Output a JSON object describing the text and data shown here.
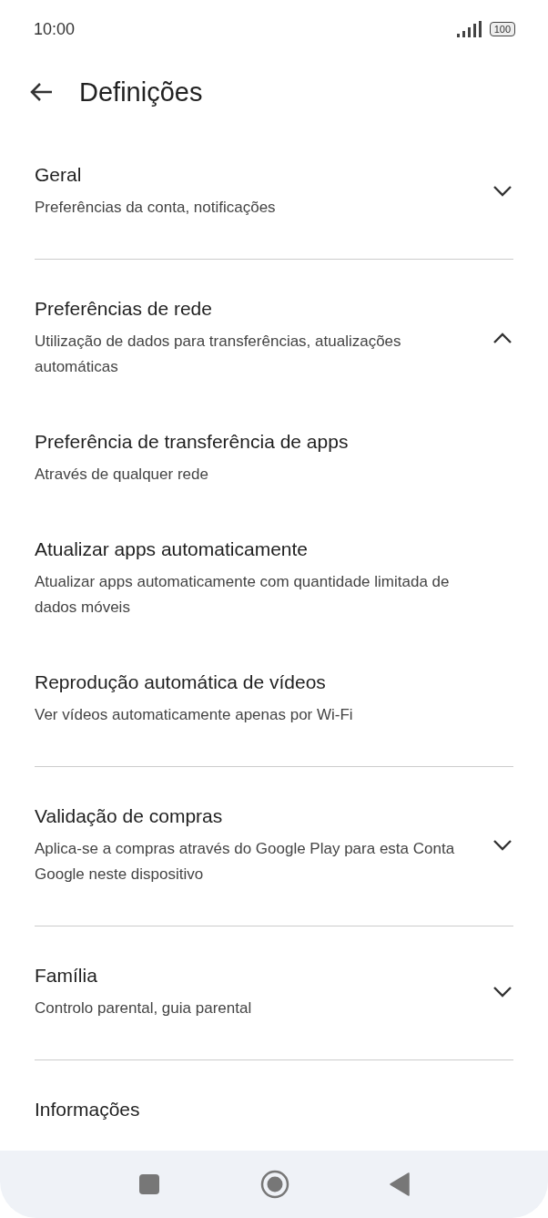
{
  "status_bar": {
    "time": "10:00",
    "battery": "100"
  },
  "header": {
    "title": "Definições"
  },
  "sections": [
    {
      "title": "Geral",
      "subtitle": "Preferências da conta, notificações",
      "expanded": false
    },
    {
      "title": "Preferências de rede",
      "subtitle": "Utilização de dados para transferências, atualizações automáticas",
      "expanded": true,
      "children": [
        {
          "title": "Preferência de transferência de apps",
          "subtitle": "Através de qualquer rede"
        },
        {
          "title": "Atualizar apps automaticamente",
          "subtitle": "Atualizar apps automaticamente com quantidade limitada de dados móveis"
        },
        {
          "title": "Reprodução automática de vídeos",
          "subtitle": "Ver vídeos automaticamente apenas por Wi-Fi"
        }
      ]
    },
    {
      "title": "Validação de compras",
      "subtitle": "Aplica-se a compras através do Google Play para esta Conta Google neste dispositivo",
      "expanded": false
    },
    {
      "title": "Família",
      "subtitle": "Controlo parental, guia parental",
      "expanded": false
    },
    {
      "title": "Informações"
    }
  ]
}
